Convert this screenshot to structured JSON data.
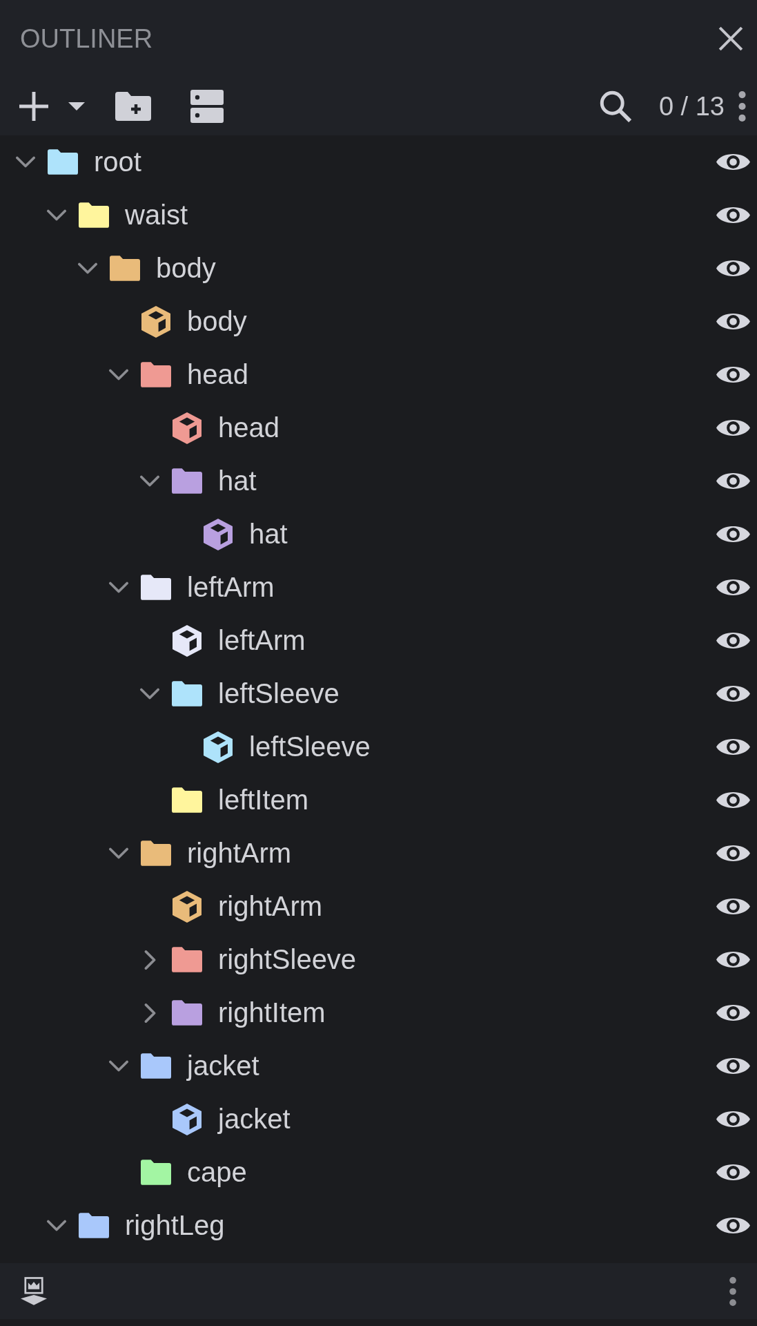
{
  "panel": {
    "title": "OUTLINER"
  },
  "toolbar": {
    "counter": "0 / 13"
  },
  "tree": [
    {
      "name": "root",
      "kind": "group",
      "color": "#aee3fb",
      "expanded": true,
      "visible": true,
      "children": [
        {
          "name": "waist",
          "kind": "group",
          "color": "#fff59d",
          "expanded": true,
          "visible": true,
          "children": [
            {
              "name": "body",
              "kind": "group",
              "color": "#e9bb7a",
              "expanded": true,
              "visible": true,
              "children": [
                {
                  "name": "body",
                  "kind": "cube",
                  "color": "#e9bb7a",
                  "visible": true
                },
                {
                  "name": "head",
                  "kind": "group",
                  "color": "#ef9a93",
                  "expanded": true,
                  "visible": true,
                  "children": [
                    {
                      "name": "head",
                      "kind": "cube",
                      "color": "#ef9a93",
                      "visible": true
                    },
                    {
                      "name": "hat",
                      "kind": "group",
                      "color": "#b9a0e0",
                      "expanded": true,
                      "visible": true,
                      "children": [
                        {
                          "name": "hat",
                          "kind": "cube",
                          "color": "#b9a0e0",
                          "visible": true
                        }
                      ]
                    }
                  ]
                },
                {
                  "name": "leftArm",
                  "kind": "group",
                  "color": "#e6e8f8",
                  "expanded": true,
                  "visible": true,
                  "children": [
                    {
                      "name": "leftArm",
                      "kind": "cube",
                      "color": "#e6e8f8",
                      "visible": true
                    },
                    {
                      "name": "leftSleeve",
                      "kind": "group",
                      "color": "#aee3fb",
                      "expanded": true,
                      "visible": true,
                      "children": [
                        {
                          "name": "leftSleeve",
                          "kind": "cube",
                          "color": "#aee3fb",
                          "visible": true
                        }
                      ]
                    },
                    {
                      "name": "leftItem",
                      "kind": "group",
                      "color": "#fff59d",
                      "visible": true
                    }
                  ]
                },
                {
                  "name": "rightArm",
                  "kind": "group",
                  "color": "#e9bb7a",
                  "expanded": true,
                  "visible": true,
                  "children": [
                    {
                      "name": "rightArm",
                      "kind": "cube",
                      "color": "#e9bb7a",
                      "visible": true
                    },
                    {
                      "name": "rightSleeve",
                      "kind": "group",
                      "color": "#ef9a93",
                      "expanded": false,
                      "visible": true
                    },
                    {
                      "name": "rightItem",
                      "kind": "group",
                      "color": "#b9a0e0",
                      "expanded": false,
                      "visible": true
                    }
                  ]
                },
                {
                  "name": "jacket",
                  "kind": "group",
                  "color": "#a9c8fb",
                  "expanded": true,
                  "visible": true,
                  "children": [
                    {
                      "name": "jacket",
                      "kind": "cube",
                      "color": "#a9c8fb",
                      "visible": true
                    }
                  ]
                },
                {
                  "name": "cape",
                  "kind": "group",
                  "color": "#a3f5a3",
                  "visible": true
                }
              ]
            }
          ]
        },
        {
          "name": "rightLeg",
          "kind": "group",
          "color": "#a9c8fb",
          "expanded": true,
          "visible": true
        }
      ]
    }
  ]
}
